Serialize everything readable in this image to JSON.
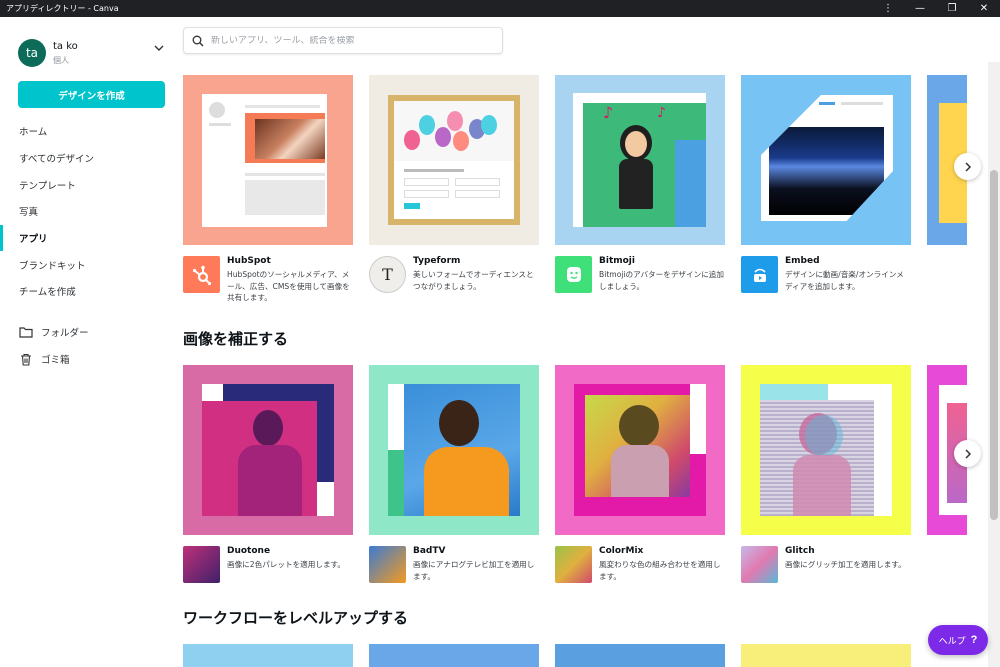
{
  "window": {
    "title": "アプリディレクトリー - Canva",
    "controls": [
      "⋮",
      "—",
      "❐",
      "✕"
    ]
  },
  "account": {
    "initials": "ta",
    "name": "ta ko",
    "plan": "個人"
  },
  "sidebar": {
    "create_button": "デザインを作成",
    "items": [
      {
        "label": "ホーム"
      },
      {
        "label": "すべてのデザイン"
      },
      {
        "label": "テンプレート"
      },
      {
        "label": "写真"
      },
      {
        "label": "アプリ"
      },
      {
        "label": "ブランドキット"
      },
      {
        "label": "チームを作成"
      }
    ],
    "active_index": 4,
    "folders_label": "フォルダー",
    "trash_label": "ゴミ箱"
  },
  "search": {
    "placeholder": "新しいアプリ、ツール、統合を検索"
  },
  "row1": {
    "apps": [
      {
        "name": "HubSpot",
        "desc": "HubSpotのソーシャルメディア、メール、広告、CMSを使用して画像を共有します。",
        "bg": "#f9a48f",
        "icon_bg": "#ff7a59",
        "icon": "hubspot-icon"
      },
      {
        "name": "Typeform",
        "desc": "美しいフォームでオーディエンスとつながりましょう。",
        "bg": "#f0ebe3",
        "icon_bg": "#efeeea",
        "icon": "typeform-icon",
        "icon_glyph": "T"
      },
      {
        "name": "Bitmoji",
        "desc": "Bitmojiのアバターをデザインに追加しましょう。",
        "bg": "#a8d4f2",
        "icon_bg": "#3fe07a",
        "icon": "bitmoji-icon"
      },
      {
        "name": "Embed",
        "desc": "デザインに動画/音楽/オンラインメディアを追加します。",
        "bg": "#77c3f4",
        "icon_bg": "#1e9be9",
        "icon": "embed-icon"
      }
    ]
  },
  "section2": {
    "title": "画像を補正する",
    "apps": [
      {
        "name": "Duotone",
        "desc": "画像に2色パレットを適用します。",
        "bg": "#d86aa6",
        "icon_bg": "#c0307a",
        "icon": "duotone-icon"
      },
      {
        "name": "BadTV",
        "desc": "画像にアナログテレビ加工を適用します。",
        "bg": "#8ee8c8",
        "icon_bg": "#3a7bd5",
        "icon": "badtv-icon"
      },
      {
        "name": "ColorMix",
        "desc": "風変わりな色の組み合わせを適用します。",
        "bg": "#f06ac6",
        "icon_bg": "#9ac24a",
        "icon": "colormix-icon"
      },
      {
        "name": "Glitch",
        "desc": "画像にグリッチ加工を適用します。",
        "bg": "#f5ff4a",
        "icon_bg": "#c6b8e8",
        "icon": "glitch-icon"
      }
    ]
  },
  "section3": {
    "title": "ワークフローをレベルアップする"
  },
  "help": {
    "label": "ヘルプ",
    "mark": "?"
  }
}
